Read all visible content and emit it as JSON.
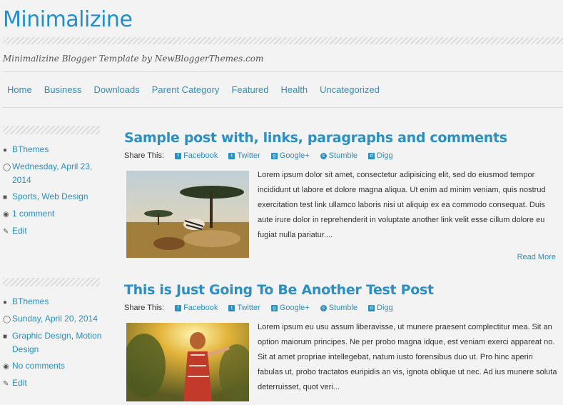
{
  "site": {
    "title": "Minimalizine",
    "tagline": "Minimalizine Blogger Template by NewBloggerThemes.com"
  },
  "nav": [
    "Home",
    "Business",
    "Downloads",
    "Parent Category",
    "Featured",
    "Health",
    "Uncategorized"
  ],
  "share": {
    "label": "Share This:",
    "links": [
      "Facebook",
      "Twitter",
      "Google+",
      "Stumble",
      "Digg"
    ]
  },
  "posts": [
    {
      "author": "BThemes",
      "date": "Wednesday, April 23, 2014",
      "categories": [
        "Sports",
        "Web Design"
      ],
      "comments": "1 comment",
      "edit": "Edit",
      "title": "Sample post with, links, paragraphs and comments",
      "excerpt": "Lorem ipsum dolor sit amet, consectetur adipisicing elit, sed do eiusmod tempor incididunt ut labore et dolore magna aliqua. Ut enim ad minim veniam, quis nostrud exercitation test link ullamco laboris nisi ut aliquip ex ea commodo consequat. Duis aute irure dolor in reprehenderit in voluptate another link velit esse cillum dolore eu fugiat nulla pariatur....",
      "read_more": "Read More"
    },
    {
      "author": "BThemes",
      "date": "Sunday, April 20, 2014",
      "categories": [
        "Graphic Design",
        "Motion Design"
      ],
      "comments": "No comments",
      "edit": "Edit",
      "title": "This is Just Going To Be Another Test Post",
      "excerpt": "Lorem ipsum eu usu assum liberavisse, ut munere praesent complectitur mea. Sit an option maiorum principes. Ne per probo magna idque, est veniam exerci appareat no. Sit at amet propriae intellegebat, natum iusto forensibus duo ut. Pro hinc aperiri fabulas ut, probo tractatos euripidis an vis, ignota oblique ut nec. Ad ius munere soluta deterruisset, quot veri..."
    }
  ],
  "colors": {
    "accent": "#1f8fcf",
    "link": "#2a8fc4",
    "background": "#f3f3f3"
  }
}
